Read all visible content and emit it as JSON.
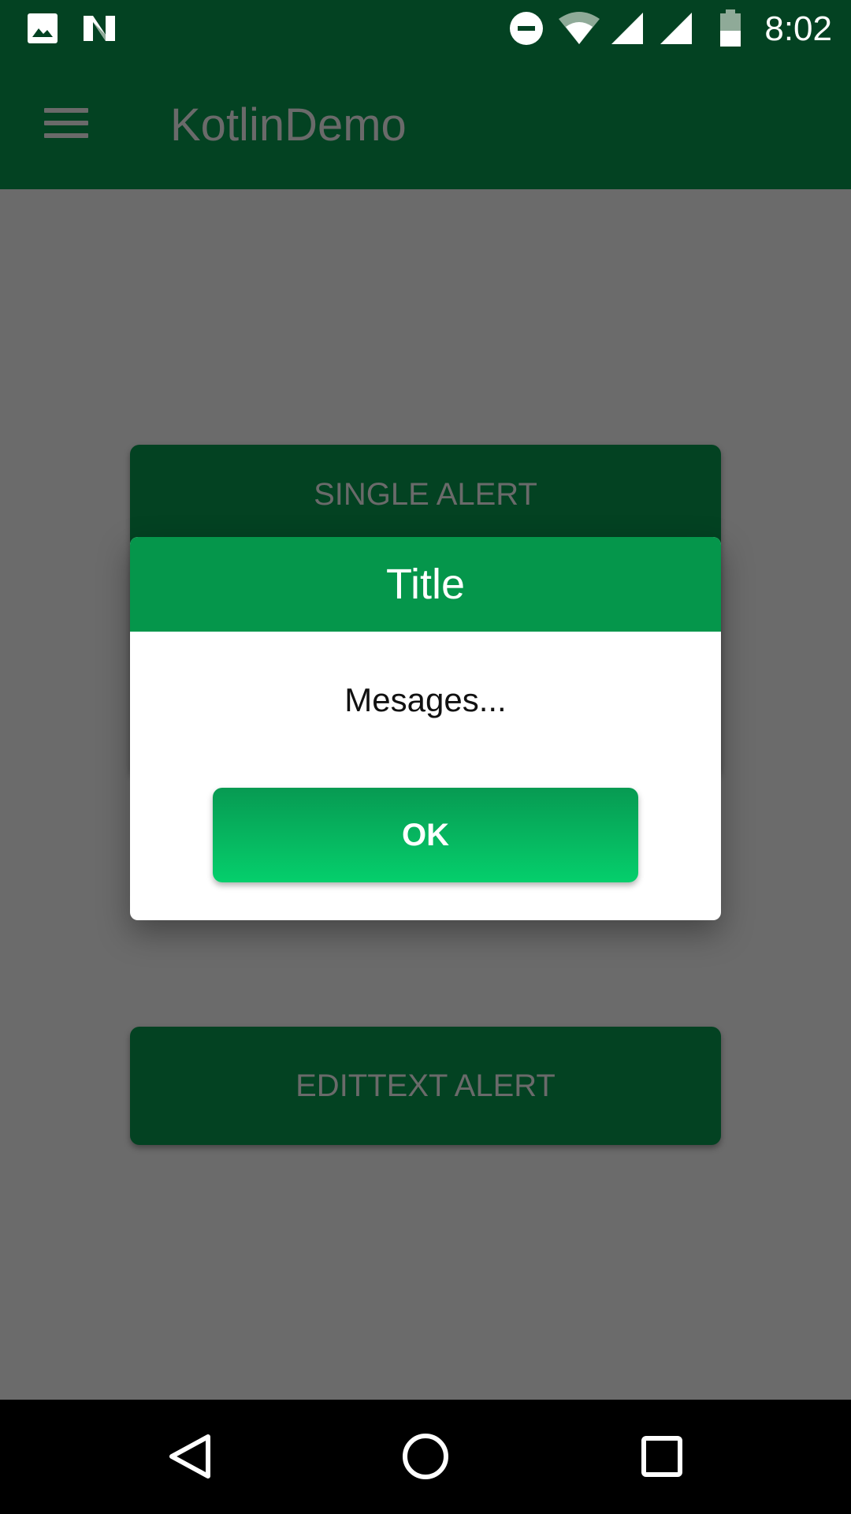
{
  "status_bar": {
    "time": "8:02",
    "icons": [
      "image-icon",
      "n-logo-icon",
      "do-not-disturb-icon",
      "wifi-icon",
      "cell-signal-icon",
      "cell-signal-icon",
      "battery-icon"
    ]
  },
  "app_bar": {
    "title": "KotlinDemo",
    "menu_icon": "hamburger-menu-icon"
  },
  "main": {
    "single_alert_label": "SINGLE ALERT",
    "edittext_alert_label": "EDITTEXT ALERT"
  },
  "dialog": {
    "title": "Title",
    "message": "Mesages...",
    "ok_label": "OK"
  },
  "nav_bar": {
    "icons": [
      "back-icon",
      "home-icon",
      "recents-icon"
    ]
  },
  "colors": {
    "primary_dark": "#034222",
    "dialog_header": "#05964b",
    "ok_gradient_top": "#079a52",
    "ok_gradient_bottom": "#05cf6c",
    "scrim_background": "#6b6b6b"
  }
}
